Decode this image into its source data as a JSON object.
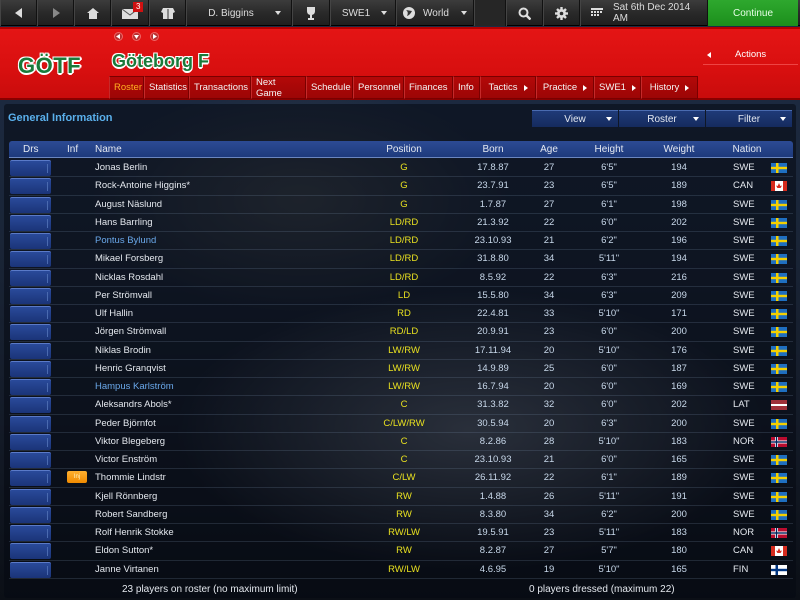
{
  "toolbar": {
    "mail_count": "3",
    "manager": "D. Biggins",
    "league": "SWE1",
    "world": "World",
    "date": "Sat 6th Dec 2014 AM",
    "continue_label": "Continue",
    "continue_color": "#2ea82e"
  },
  "header": {
    "logo_text": "GÖTF",
    "team_name": "Göteborg F",
    "actions_label": "Actions",
    "brand_color": "#e41515",
    "team_color": "#1a7a3a",
    "tabs": [
      {
        "label": "Roster",
        "active": true
      },
      {
        "label": "Statistics"
      },
      {
        "label": "Transactions"
      },
      {
        "label": "Next Game"
      },
      {
        "label": "Schedule"
      },
      {
        "label": "Personnel"
      },
      {
        "label": "Finances"
      },
      {
        "label": "Info"
      },
      {
        "label": "Tactics",
        "submenu": true
      },
      {
        "label": "Practice",
        "submenu": true
      },
      {
        "label": "SWE1",
        "submenu": true
      },
      {
        "label": "History",
        "submenu": true
      }
    ]
  },
  "panel": {
    "title": "General Information",
    "controls": {
      "view": "View",
      "roster": "Roster",
      "filter": "Filter"
    },
    "columns": {
      "drs": "Drs",
      "inf": "Inf",
      "name": "Name",
      "position": "Position",
      "born": "Born",
      "age": "Age",
      "height": "Height",
      "weight": "Weight",
      "nation": "Nation"
    },
    "players": [
      {
        "name": "Jonas Berlin",
        "pos": "G",
        "born": "17.8.87",
        "age": "27",
        "height": "6'5\"",
        "weight": "194",
        "nation": "SWE"
      },
      {
        "name": "Rock-Antoine Higgins*",
        "pos": "G",
        "born": "23.7.91",
        "age": "23",
        "height": "6'5\"",
        "weight": "189",
        "nation": "CAN"
      },
      {
        "name": "August Näslund",
        "pos": "G",
        "born": "1.7.87",
        "age": "27",
        "height": "6'1\"",
        "weight": "198",
        "nation": "SWE"
      },
      {
        "name": "Hans Barrling",
        "pos": "LD/RD",
        "born": "21.3.92",
        "age": "22",
        "height": "6'0\"",
        "weight": "202",
        "nation": "SWE"
      },
      {
        "name": "Pontus Bylund",
        "pos": "LD/RD",
        "born": "23.10.93",
        "age": "21",
        "height": "6'2\"",
        "weight": "196",
        "nation": "SWE",
        "highlight": true
      },
      {
        "name": "Mikael Forsberg",
        "pos": "LD/RD",
        "born": "31.8.80",
        "age": "34",
        "height": "5'11\"",
        "weight": "194",
        "nation": "SWE"
      },
      {
        "name": "Nicklas Rosdahl",
        "pos": "LD/RD",
        "born": "8.5.92",
        "age": "22",
        "height": "6'3\"",
        "weight": "216",
        "nation": "SWE"
      },
      {
        "name": "Per Strömvall",
        "pos": "LD",
        "born": "15.5.80",
        "age": "34",
        "height": "6'3\"",
        "weight": "209",
        "nation": "SWE"
      },
      {
        "name": "Ulf Hallin",
        "pos": "RD",
        "born": "22.4.81",
        "age": "33",
        "height": "5'10\"",
        "weight": "171",
        "nation": "SWE"
      },
      {
        "name": "Jörgen Strömvall",
        "pos": "RD/LD",
        "born": "20.9.91",
        "age": "23",
        "height": "6'0\"",
        "weight": "200",
        "nation": "SWE"
      },
      {
        "name": "Niklas Brodin",
        "pos": "LW/RW",
        "born": "17.11.94",
        "age": "20",
        "height": "5'10\"",
        "weight": "176",
        "nation": "SWE"
      },
      {
        "name": "Henric Granqvist",
        "pos": "LW/RW",
        "born": "14.9.89",
        "age": "25",
        "height": "6'0\"",
        "weight": "187",
        "nation": "SWE"
      },
      {
        "name": "Hampus Karlström",
        "pos": "LW/RW",
        "born": "16.7.94",
        "age": "20",
        "height": "6'0\"",
        "weight": "169",
        "nation": "SWE",
        "highlight": true
      },
      {
        "name": "Aleksandrs Abols*",
        "pos": "C",
        "born": "31.3.82",
        "age": "32",
        "height": "6'0\"",
        "weight": "202",
        "nation": "LAT"
      },
      {
        "name": "Peder Björnfot",
        "pos": "C/LW/RW",
        "born": "30.5.94",
        "age": "20",
        "height": "6'3\"",
        "weight": "200",
        "nation": "SWE"
      },
      {
        "name": "Viktor Blegeberg",
        "pos": "C",
        "born": "8.2.86",
        "age": "28",
        "height": "5'10\"",
        "weight": "183",
        "nation": "NOR"
      },
      {
        "name": "Victor Enström",
        "pos": "C",
        "born": "23.10.93",
        "age": "21",
        "height": "6'0\"",
        "weight": "165",
        "nation": "SWE"
      },
      {
        "name": "Thommie Lindstr",
        "pos": "C/LW",
        "born": "26.11.92",
        "age": "22",
        "height": "6'1\"",
        "weight": "189",
        "nation": "SWE",
        "injury": "Inj"
      },
      {
        "name": "Kjell Rönnberg",
        "pos": "RW",
        "born": "1.4.88",
        "age": "26",
        "height": "5'11\"",
        "weight": "191",
        "nation": "SWE"
      },
      {
        "name": "Robert Sandberg",
        "pos": "RW",
        "born": "8.3.80",
        "age": "34",
        "height": "6'2\"",
        "weight": "200",
        "nation": "SWE"
      },
      {
        "name": "Rolf Henrik Stokke",
        "pos": "RW/LW",
        "born": "19.5.91",
        "age": "23",
        "height": "5'11\"",
        "weight": "183",
        "nation": "NOR"
      },
      {
        "name": "Eldon Sutton*",
        "pos": "RW",
        "born": "8.2.87",
        "age": "27",
        "height": "5'7\"",
        "weight": "180",
        "nation": "CAN"
      },
      {
        "name": "Janne Virtanen",
        "pos": "RW/LW",
        "born": "4.6.95",
        "age": "19",
        "height": "5'10\"",
        "weight": "165",
        "nation": "FIN"
      }
    ],
    "footer": {
      "roster_count": "23 players on roster (no maximum limit)",
      "dressed_count": "0 players dressed (maximum 22)"
    }
  }
}
